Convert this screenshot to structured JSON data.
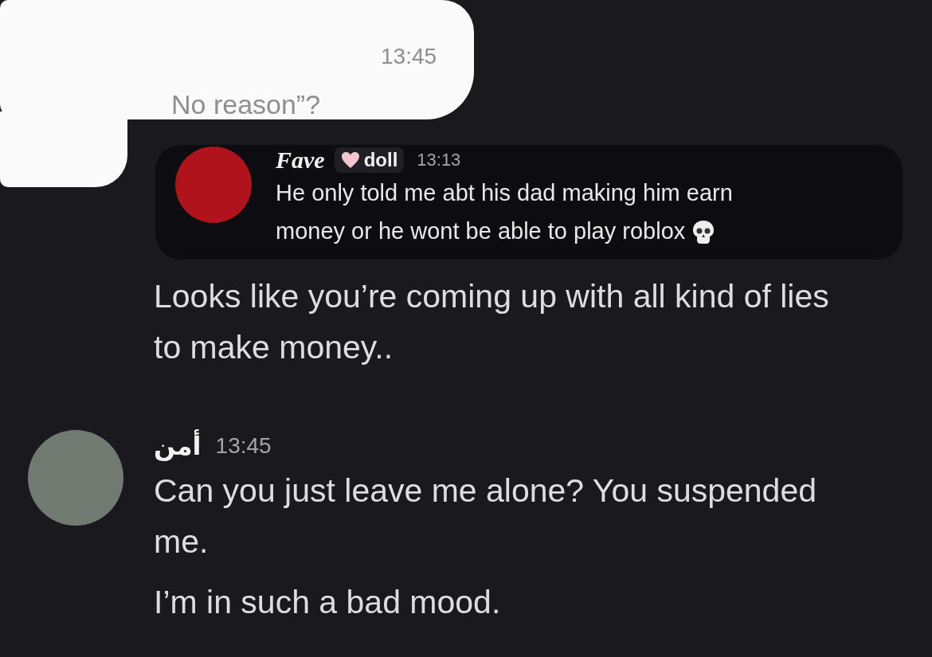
{
  "redacted_message": {
    "time": "13:45",
    "text": "No reason”?"
  },
  "reply": {
    "author": "Fave",
    "badge": "doll",
    "time": "13:13",
    "text": "He only told me abt his dad making him earn money or he wont be able to play roblox"
  },
  "continued_messages": [
    "Looks like you’re coming up with all kind of lies to make money.."
  ],
  "group": {
    "author": "أمن",
    "time": "13:45",
    "messages": [
      "Can you just leave me alone? You suspended me.",
      "I’m in such a bad mood."
    ]
  }
}
